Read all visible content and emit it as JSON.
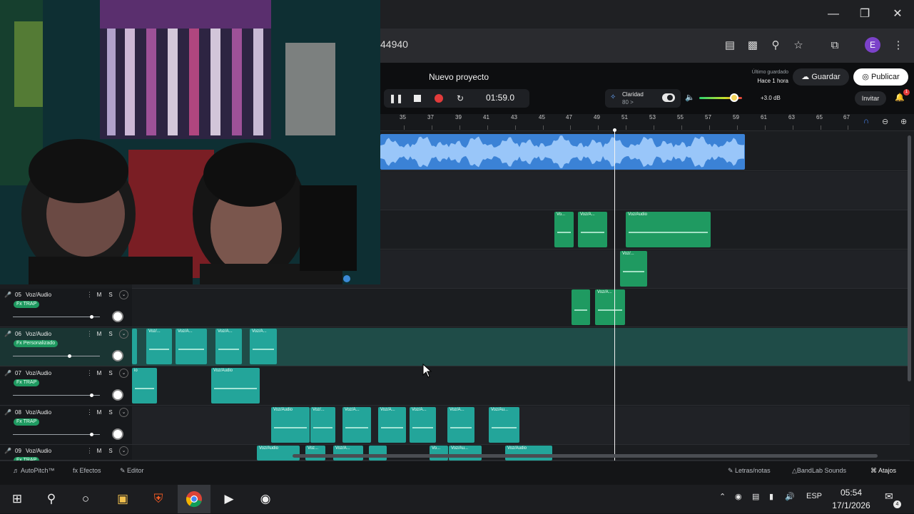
{
  "browser": {
    "url_fragment": "44940",
    "profile_initial": "E",
    "window_controls": [
      "minimize-icon",
      "restore-icon",
      "close-icon"
    ],
    "toolbar_icons": [
      "piano-icon",
      "cast-icon",
      "zoom-icon",
      "bookmark-star-icon",
      "extensions-icon",
      "menu-icon"
    ]
  },
  "daw": {
    "project_title": "Nuevo proyecto",
    "timecode": "01:59.0",
    "clarity_label": "Claridad",
    "clarity_value": "80 >",
    "volume_db": "+3.0 dB",
    "last_saved_label": "Último guardado",
    "last_saved_time": "Hace 1 hora",
    "save_label": "Guardar",
    "publish_label": "Publicar",
    "invite_label": "Invitar",
    "notification_count": "1",
    "ruler_ticks": [
      "35",
      "37",
      "39",
      "41",
      "43",
      "45",
      "47",
      "49",
      "51",
      "53",
      "55",
      "57",
      "59",
      "61",
      "63",
      "65",
      "67"
    ],
    "tracks": [
      {
        "number": "05",
        "name": "Voz/Audio",
        "fx": "Fx TRAP",
        "m": "M",
        "s": "S",
        "volume": 0.9
      },
      {
        "number": "06",
        "name": "Voz/Audio",
        "fx": "Fx Personalizado",
        "m": "M",
        "s": "S",
        "volume": 0.65
      },
      {
        "number": "07",
        "name": "Voz/Audio",
        "fx": "Fx TRAP",
        "m": "M",
        "s": "S",
        "volume": 0.9
      },
      {
        "number": "08",
        "name": "Voz/Audio",
        "fx": "Fx TRAP",
        "m": "M",
        "s": "S",
        "volume": 0.9
      },
      {
        "number": "09",
        "name": "Voz/Audio",
        "fx": "Fx TRAP",
        "m": "M",
        "s": "S",
        "volume": 0.9
      }
    ],
    "clip_labels": {
      "voz_audio": "Voz/Audio",
      "voz_short": "Voz/...",
      "voz_a": "Voz/A...",
      "voz_au": "Voz/Au...",
      "voz_dots": "Voz...",
      "vo": "Vo...",
      "io": "io"
    },
    "bottom_left": [
      "AutoPitch™",
      "Efectos",
      "Editor"
    ],
    "bottom_right": [
      "Letras/notas",
      "BandLab Sounds",
      "Atajos"
    ]
  },
  "taskbar": {
    "apps": [
      "windows-start-icon",
      "search-icon",
      "task-view-icon",
      "file-explorer-icon",
      "brave-browser-icon",
      "chrome-icon",
      "media-player-icon",
      "bandlab-icon"
    ],
    "language": "ESP",
    "time": "05:54",
    "date": "17/1/2026",
    "notification_count": "4"
  },
  "colors": {
    "accent_green": "#1f9a61",
    "accent_teal": "#23a59a",
    "accent_blue": "#3b82d6",
    "record_red": "#e23b3b"
  }
}
